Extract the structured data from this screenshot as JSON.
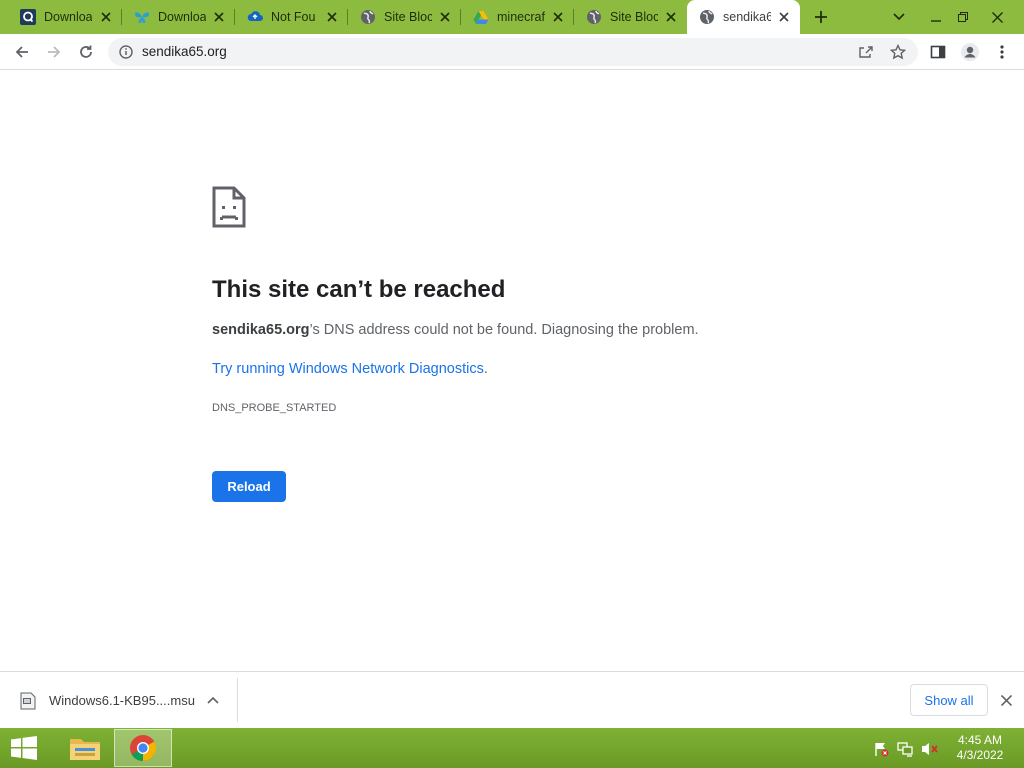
{
  "tabs": [
    {
      "title": "Downloa",
      "icon": "q-logo-icon",
      "active": false
    },
    {
      "title": "Downloa",
      "icon": "butterfly-icon",
      "active": false
    },
    {
      "title": "Not Fou",
      "icon": "cloud-icon",
      "active": false
    },
    {
      "title": "Site Block",
      "icon": "globe-icon",
      "active": false
    },
    {
      "title": "minecraf",
      "icon": "drive-icon",
      "active": false
    },
    {
      "title": "Site Block",
      "icon": "globe-icon",
      "active": false
    },
    {
      "title": "sendika6",
      "icon": "globe-icon",
      "active": true
    }
  ],
  "address": {
    "url": "sendika65.org"
  },
  "error": {
    "title": "This site can’t be reached",
    "host": "sendika65.org",
    "message_rest": "’s DNS address could not be found. Diagnosing the problem.",
    "link_text": "Try running Windows Network Diagnostics",
    "link_suffix": ".",
    "code": "DNS_PROBE_STARTED",
    "reload_label": "Reload"
  },
  "download": {
    "file_name": "Windows6.1-KB95....msu",
    "show_all_label": "Show all"
  },
  "taskbar": {
    "time": "4:45 AM",
    "date": "4/3/2022"
  },
  "colors": {
    "frame": "#8dbb3f",
    "taskbar": "#7fb135",
    "accent": "#1a73e8"
  }
}
